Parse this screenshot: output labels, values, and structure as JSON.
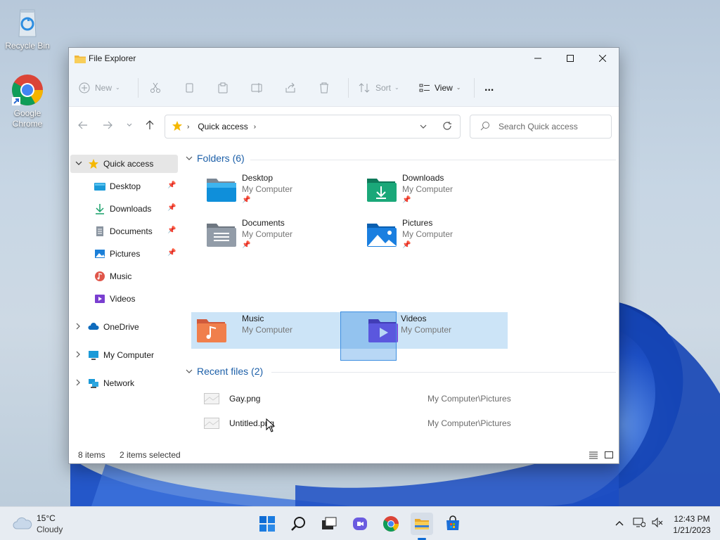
{
  "desktop": {
    "icons": [
      {
        "label": "Recycle Bin"
      },
      {
        "label": "Google Chrome"
      }
    ]
  },
  "window": {
    "title": "File Explorer",
    "toolbar": {
      "new_label": "New",
      "sort_label": "Sort",
      "view_label": "View",
      "more_label": "..."
    },
    "address": {
      "location": "Quick access",
      "search_placeholder": "Search Quick access"
    },
    "sidebar": {
      "items": [
        {
          "label": "Quick access"
        },
        {
          "label": "Desktop"
        },
        {
          "label": "Downloads"
        },
        {
          "label": "Documents"
        },
        {
          "label": "Pictures"
        },
        {
          "label": "Music"
        },
        {
          "label": "Videos"
        },
        {
          "label": "OneDrive"
        },
        {
          "label": "My Computer"
        },
        {
          "label": "Network"
        }
      ]
    },
    "folders_header": "Folders (6)",
    "folders": [
      {
        "name": "Desktop",
        "location": "My Computer"
      },
      {
        "name": "Downloads",
        "location": "My Computer"
      },
      {
        "name": "Documents",
        "location": "My Computer"
      },
      {
        "name": "Pictures",
        "location": "My Computer"
      },
      {
        "name": "Music",
        "location": "My Computer"
      },
      {
        "name": "Videos",
        "location": "My Computer"
      }
    ],
    "recent_header": "Recent files (2)",
    "recent_files": [
      {
        "name": "Gay.png",
        "path": "My Computer\\Pictures"
      },
      {
        "name": "Untitled.png",
        "path": "My Computer\\Pictures"
      }
    ],
    "status": {
      "items": "8 items",
      "selected": "2 items selected"
    }
  },
  "taskbar": {
    "weather_temp": "15°C",
    "weather_desc": "Cloudy",
    "time": "12:43 PM",
    "date": "1/21/2023"
  },
  "colors": {
    "accent": "#1c5fa8",
    "selection": "#cce4f7"
  }
}
